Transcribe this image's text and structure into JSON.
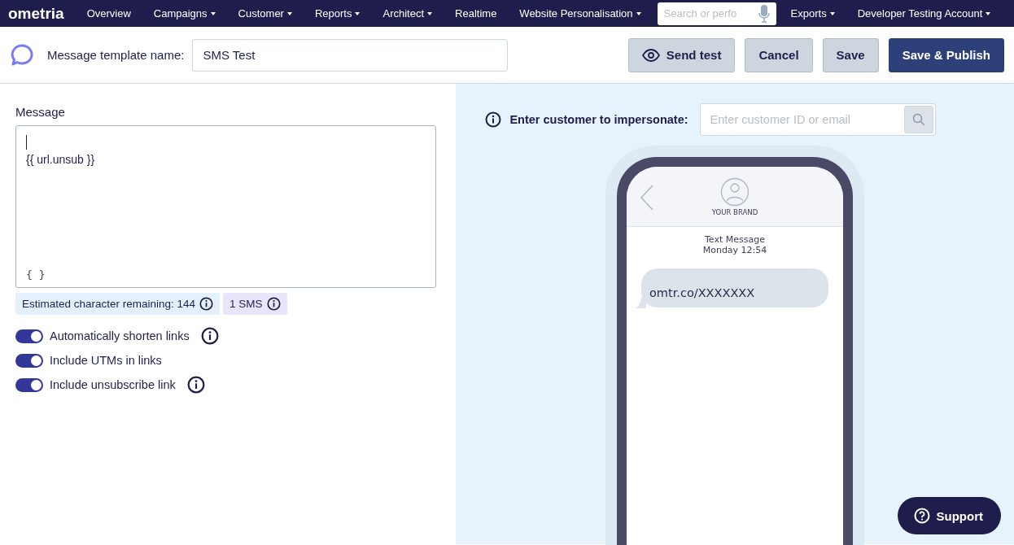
{
  "nav": {
    "logo": "ometria",
    "items": [
      {
        "label": "Overview",
        "dropdown": false
      },
      {
        "label": "Campaigns",
        "dropdown": true
      },
      {
        "label": "Customer",
        "dropdown": true
      },
      {
        "label": "Reports",
        "dropdown": true
      },
      {
        "label": "Architect",
        "dropdown": true
      },
      {
        "label": "Realtime",
        "dropdown": false
      },
      {
        "label": "Website Personalisation",
        "dropdown": true
      }
    ],
    "search": {
      "placeholder": "Search or perfo"
    },
    "right_items": [
      {
        "label": "Exports",
        "dropdown": true
      },
      {
        "label": "Developer Testing Account",
        "dropdown": true
      }
    ]
  },
  "toolbar": {
    "name_label": "Message template name:",
    "name_value": "SMS Test",
    "buttons": [
      {
        "label": "Send test",
        "kind": "preview"
      },
      {
        "label": "Cancel",
        "kind": "secondary"
      },
      {
        "label": "Save",
        "kind": "secondary"
      },
      {
        "label": "Save & Publish",
        "kind": "primary"
      }
    ]
  },
  "editor": {
    "label": "Message",
    "text": "{{ url.unsub }}",
    "variables_button": "{ }",
    "badges": [
      {
        "text": "Estimated character remaining: 144",
        "kind": "count"
      },
      {
        "text": "1 SMS",
        "kind": "sms"
      }
    ],
    "toggles": [
      {
        "label": "Automatically shorten links",
        "on": true,
        "info": true
      },
      {
        "label": "Include UTMs in links",
        "on": true,
        "info": false
      },
      {
        "label": "Include unsubscribe link",
        "on": true,
        "info": true
      }
    ]
  },
  "preview": {
    "impersonate_label": "Enter customer to impersonate:",
    "impersonate_placeholder": "Enter customer ID or email",
    "brand": "YOUR BRAND",
    "header_title": "Text Message",
    "header_time": "Monday 12:54",
    "bubble": "omtr.co/XXXXXXX"
  },
  "support": {
    "label": "Support"
  }
}
